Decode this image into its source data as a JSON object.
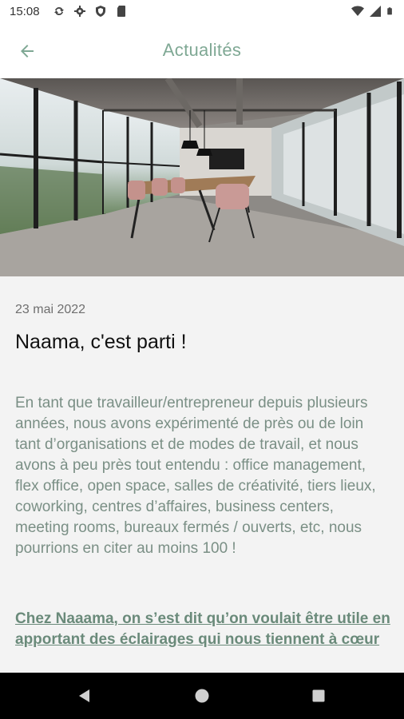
{
  "status_bar": {
    "time": "15:08",
    "left_icons": [
      "sync-icon",
      "gear-icon",
      "shield-icon",
      "sd-card-icon"
    ],
    "right_icons": [
      "wifi-icon",
      "signal-icon",
      "battery-icon"
    ]
  },
  "app_bar": {
    "title": "Actualités",
    "back_icon": "arrow-left-icon"
  },
  "colors": {
    "accent": "#7fa894",
    "body_text": "#7a8f85",
    "link_text": "#6a8a7a",
    "content_bg": "#f3f3f3"
  },
  "article": {
    "date": "23 mai 2022",
    "title": "Naama, c'est parti !",
    "body": "En tant que travailleur/entrepreneur depuis plusieurs années, nous avons expérimenté de près ou de loin tant d’organisations et de modes de travail, et nous avons à peu près tout entendu : office management, flex office, open space, salles de créativité, tiers lieux, coworking, centres d’affaires, business centers, meeting rooms, bureaux fermés / ouverts, etc, nous pourrions en citer au moins 100 !",
    "link": "Chez Naaama, on s’est dit qu’on voulait être utile en apportant des éclairages qui nous tiennent à cœur"
  },
  "nav_bar": {
    "buttons": [
      "back-triangle-icon",
      "home-circle-icon",
      "recents-square-icon"
    ]
  }
}
